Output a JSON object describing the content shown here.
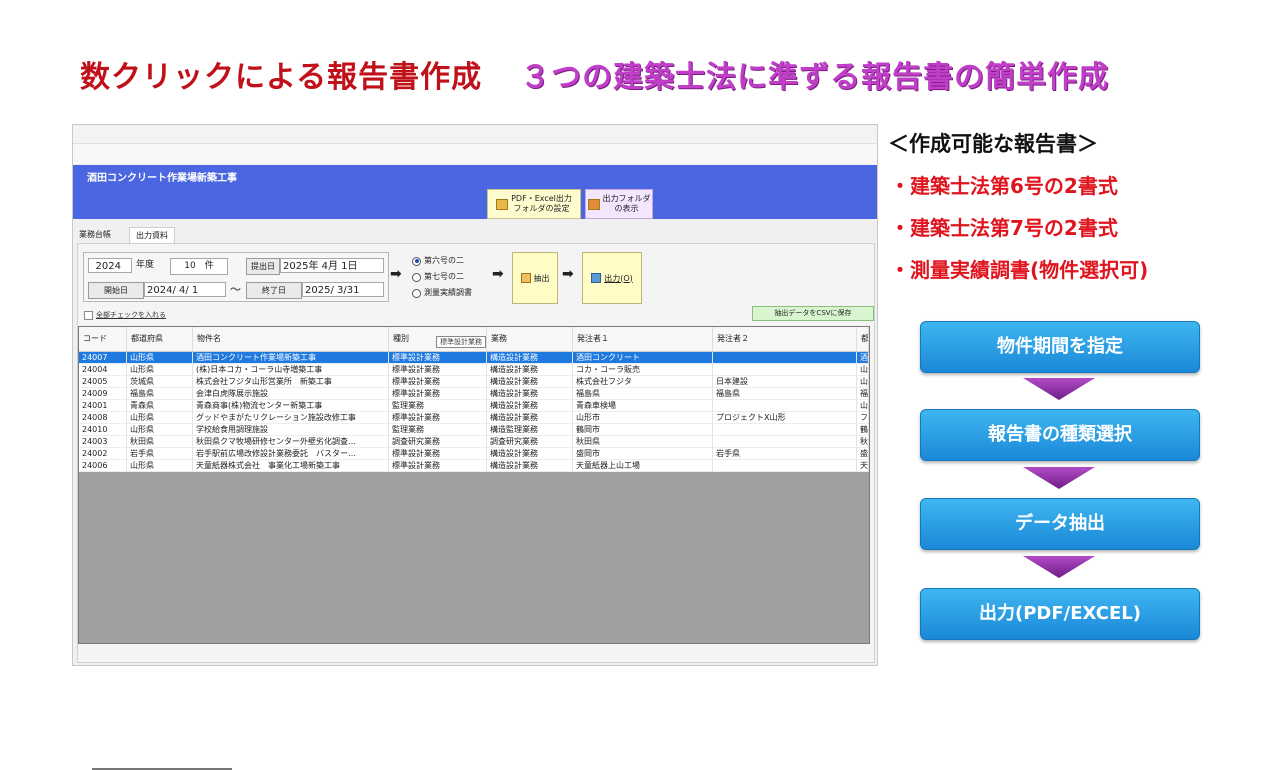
{
  "headline": {
    "left": "数クリックによる報告書作成",
    "right": "３つの建築士法に準ずる報告書の簡単作成"
  },
  "window": {
    "title": "酒田コンクリート作業場新築工事",
    "btn_pdf_excel": "PDF・Excel出力\nフォルダの設定",
    "btn_pdf_excel_l1": "PDF・Excel出力",
    "btn_pdf_excel_l2": "フォルダの設定",
    "btn_folder_l1": "出力フォルダ",
    "btn_folder_l2": "の表示",
    "tabs": [
      "業務台帳",
      "出力資料"
    ],
    "filter": {
      "year": "2024",
      "year_label": "年度",
      "count": "10　件",
      "submit_label": "提出日",
      "submit_value": "2025年  4月  1日",
      "start_label": "開始日",
      "start_value": "2024/  4/  1",
      "tilde": "～",
      "end_label": "終了日",
      "end_value": "2025/  3/31"
    },
    "radios": [
      "第六号の二",
      "第七号の二",
      "測量実績調書"
    ],
    "extract_button": "抽出",
    "output_button": "出力(O)",
    "check_all": "全部チェックを入れる",
    "csv_button": "抽出データをCSVに保存",
    "tooltip": "標準設計業務",
    "columns": [
      "コード",
      "都道府県",
      "物件名",
      "種別",
      "業務",
      "発注者１",
      "発注者２",
      "都"
    ],
    "rows": [
      [
        "24007",
        "山形県",
        "酒田コンクリート作業場新築工事",
        "標準設計業務",
        "構造設計業務",
        "酒田コンクリート",
        "",
        "酒"
      ],
      [
        "24004",
        "山形県",
        "(株)日本コカ・コーラ山寺増築工事",
        "標準設計業務",
        "構造設計業務",
        "コカ・コーラ販売",
        "",
        "山"
      ],
      [
        "24005",
        "茨城県",
        "株式会社フジタ山形営業所　新築工事",
        "標準設計業務",
        "構造設計業務",
        "株式会社フジタ",
        "日本建設",
        "山"
      ],
      [
        "24009",
        "福島県",
        "会津白虎隊展示施設",
        "標準設計業務",
        "構造設計業務",
        "福島県",
        "福島県",
        "福"
      ],
      [
        "24001",
        "青森県",
        "青森商事(株)物流センター新築工事",
        "監理業務",
        "構造設計業務",
        "青森車検場",
        "",
        "山"
      ],
      [
        "24008",
        "山形県",
        "グッドやまがたリクレーション施設改修工事",
        "標準設計業務",
        "構造設計業務",
        "山形市",
        "プロジェクトX山形",
        "フ"
      ],
      [
        "24010",
        "山形県",
        "学校給食用調理施設",
        "監理業務",
        "構造監理業務",
        "鶴岡市",
        "",
        "鶴"
      ],
      [
        "24003",
        "秋田県",
        "秋田県クマ牧場研修センター外壁劣化調査…",
        "調査研究業務",
        "調査研究業務",
        "秋田県",
        "",
        "秋"
      ],
      [
        "24002",
        "岩手県",
        "岩手駅前広場改修設計業務委託　バスター…",
        "標準設計業務",
        "構造設計業務",
        "盛岡市",
        "岩手県",
        "盛"
      ],
      [
        "24006",
        "山形県",
        "天童紙器株式会社　事業化工場新築工事",
        "標準設計業務",
        "構造設計業務",
        "天童紙器上山工場",
        "",
        "天"
      ]
    ]
  },
  "right": {
    "title": "＜作成可能な報告書＞",
    "bullets": [
      "・建築士法第6号の2書式",
      "・建築士法第7号の2書式",
      "・測量実績調書(物件選択可)"
    ],
    "flow": [
      "物件期間を指定",
      "報告書の種類選択",
      "データ抽出",
      "出力(PDF/EXCEL)"
    ]
  }
}
